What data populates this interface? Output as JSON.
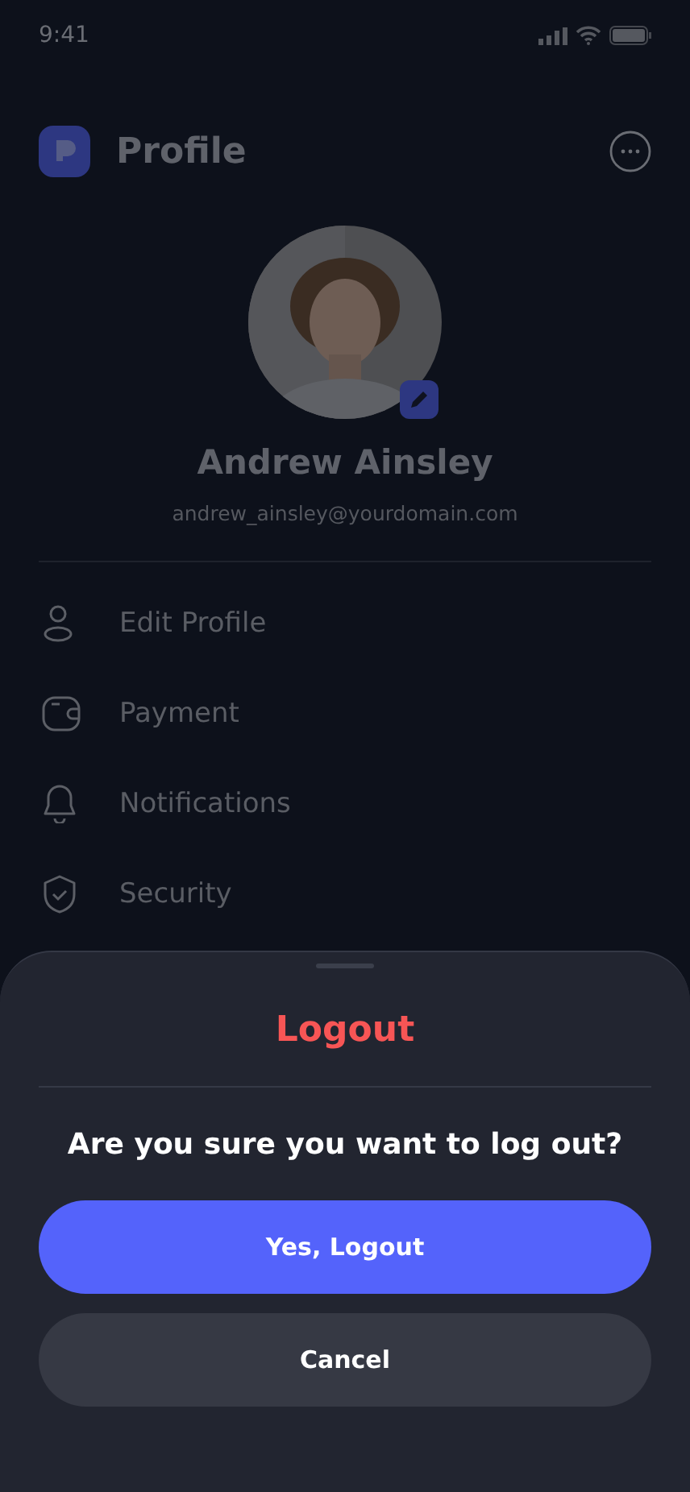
{
  "status_bar": {
    "time": "9:41"
  },
  "header": {
    "title": "Profile"
  },
  "profile": {
    "name": "Andrew Ainsley",
    "email": "andrew_ainsley@yourdomain.com"
  },
  "menu": [
    {
      "kind": "person",
      "label": "Edit Profile"
    },
    {
      "kind": "wallet",
      "label": "Payment"
    },
    {
      "kind": "bell",
      "label": "Notifications"
    },
    {
      "kind": "shield",
      "label": "Security"
    }
  ],
  "sheet": {
    "title": "Logout",
    "message": "Are you sure you want to log out?",
    "buttons": [
      {
        "kind": "primary",
        "label": "Yes, Logout"
      },
      {
        "kind": "secondary",
        "label": "Cancel"
      }
    ]
  }
}
